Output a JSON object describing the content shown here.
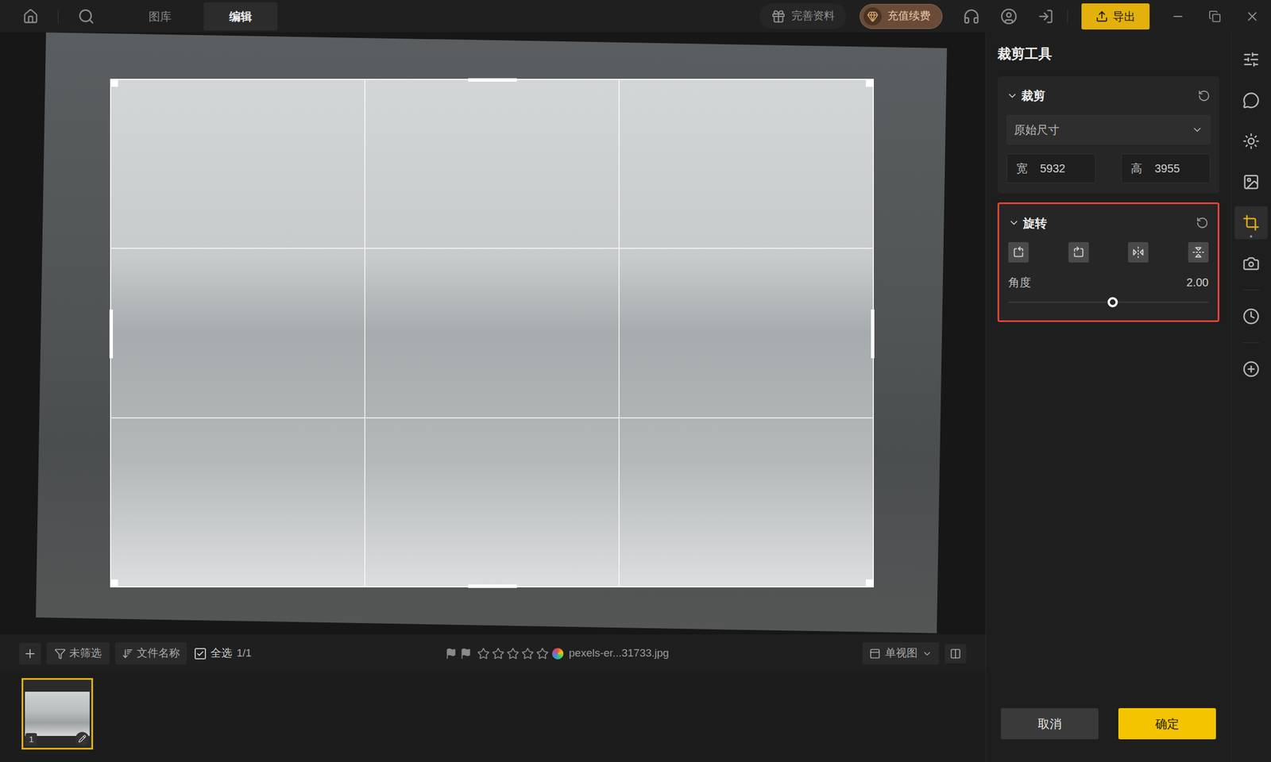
{
  "top_bar": {
    "tabs": [
      {
        "label": "图库",
        "selected": false
      },
      {
        "label": "编辑",
        "selected": true
      }
    ],
    "profile_button": "完善资料",
    "vip_button": "充值续费",
    "export_button": "导出"
  },
  "canvas": {
    "photo_rotation_deg": 1,
    "crop_grid": true
  },
  "panel": {
    "title": "裁剪工具",
    "crop": {
      "title": "裁剪",
      "expanded": true,
      "preset": "原始尺寸",
      "width_label": "宽",
      "width": "5932",
      "height_label": "高",
      "height": "3955"
    },
    "rotate": {
      "title": "旋转",
      "expanded": true,
      "highlighted": true,
      "angle_label": "角度",
      "angle": "2.00",
      "level": 0.52
    },
    "buttons": [
      {
        "label": "取消",
        "primary": false
      },
      {
        "label": "确定",
        "primary": true
      }
    ]
  },
  "rail": [
    {
      "selected": false
    },
    {
      "selected": false
    },
    {
      "selected": false
    },
    {
      "selected": false
    },
    {
      "selected": true
    },
    {
      "selected": false
    },
    {
      "selected": false
    },
    {
      "selected": false
    }
  ],
  "toolbar": {
    "filter": "未筛选",
    "sort": "文件名称",
    "select_all": {
      "label": "全选",
      "checked": true,
      "count": "1/1"
    },
    "stars": 0,
    "filename": "pexels-er...31733.jpg",
    "view": "单视图"
  },
  "filmstrip": [
    {
      "index": "1",
      "selected": true
    }
  ]
}
